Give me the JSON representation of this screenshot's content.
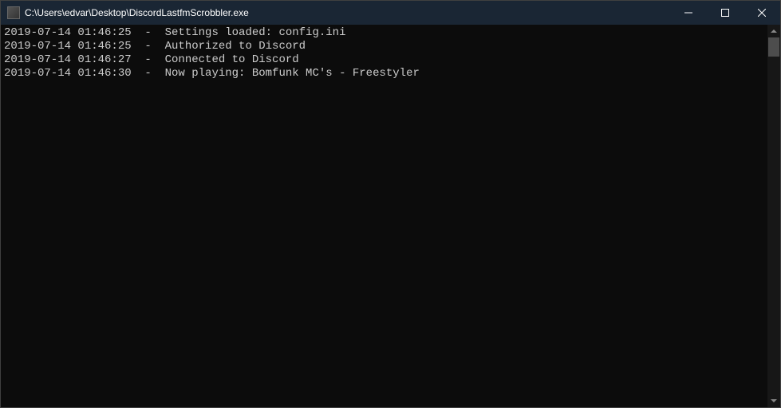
{
  "window": {
    "title": "C:\\Users\\edvar\\Desktop\\DiscordLastfmScrobbler.exe"
  },
  "log": {
    "separator": "  -  ",
    "lines": [
      {
        "timestamp": "2019-07-14 01:46:25",
        "message": "Settings loaded: config.ini"
      },
      {
        "timestamp": "2019-07-14 01:46:25",
        "message": "Authorized to Discord"
      },
      {
        "timestamp": "2019-07-14 01:46:27",
        "message": "Connected to Discord"
      },
      {
        "timestamp": "2019-07-14 01:46:30",
        "message": "Now playing: Bomfunk MC's - Freestyler"
      }
    ]
  }
}
